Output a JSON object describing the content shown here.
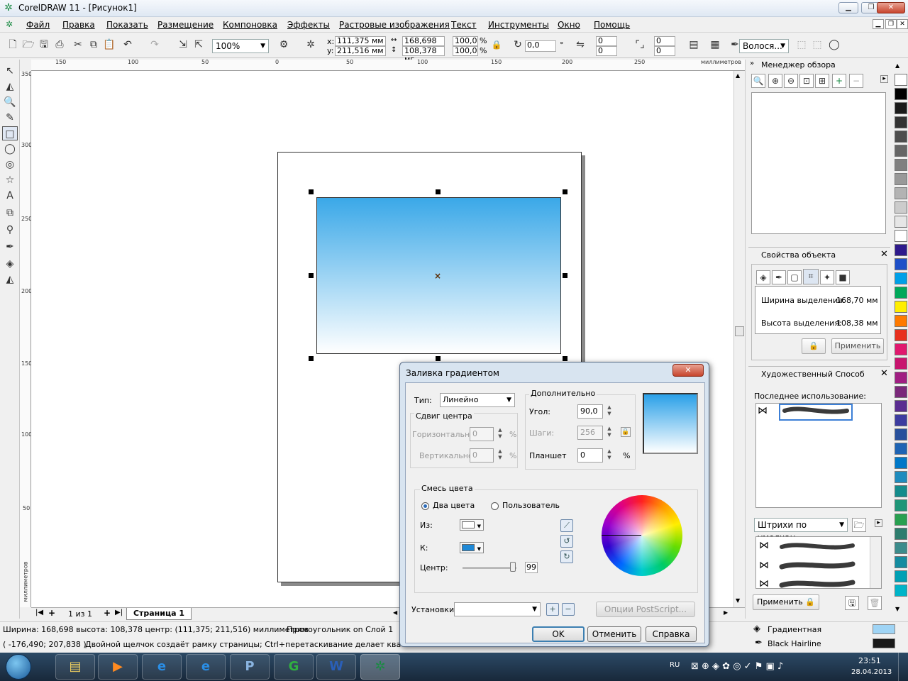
{
  "window": {
    "title": "CorelDRAW 11 - [Рисунок1]",
    "app_icon": "corel-balloon-icon"
  },
  "menu": [
    "Файл",
    "Правка",
    "Показать",
    "Размещение",
    "Компоновка",
    "Эффекты",
    "Растровые изображения",
    "Текст",
    "Инструменты",
    "Окно",
    "Помощь"
  ],
  "toolbar": {
    "zoom": "100%",
    "x_label": "x:",
    "x": "111,375 мм",
    "y_label": "y:",
    "y": "211,516 мм",
    "w": "168,698 мг",
    "h": "108,378 мг",
    "scale_x": "100,0",
    "scale_y": "100,0",
    "pct": "%",
    "angle": "0,0",
    "deg": "°",
    "corner1": "0",
    "corner2": "0",
    "corner3": "0",
    "corner4": "0",
    "outline": "Волося..."
  },
  "ruler": {
    "h_ticks": [
      "150",
      "100",
      "50",
      "0",
      "50",
      "100",
      "150",
      "200",
      "250"
    ],
    "units": "миллиметров",
    "v_ticks": [
      "350",
      "300",
      "250",
      "200",
      "150",
      "100",
      "50"
    ],
    "v_units": "миллиметров"
  },
  "pagebar": {
    "counter": "1 из 1",
    "tab": "Страница 1"
  },
  "status": {
    "line1": "Ширина: 168,698  высота: 108,378  центр: (111,375; 211,516)  миллиметров",
    "object": "Прямоугольник on Слой 1",
    "coords": "( -176,490; 207,838 )",
    "hint": "Двойной щелчок создаёт рамку страницы; Ctrl+перетаскивание делает квадрат; Shift+",
    "fill_label": "Градиентная",
    "outline_label": "Black  Hairline",
    "fill_color": "#9fd4f5",
    "outline_color": "#1a1a1a"
  },
  "docker": {
    "view_manager": {
      "title": "Менеджер обзора"
    },
    "object_props": {
      "title": "Свойства объекта",
      "width_label": "Ширина выделения:",
      "width_value": "168,70 мм",
      "height_label": "Высота выделения:",
      "height_value": "108,38 мм",
      "apply": "Применить"
    },
    "artistic": {
      "title": "Художественный Способ",
      "recent": "Последнее использование:",
      "preset": "Штрихи по умолчан...",
      "apply": "Применить"
    }
  },
  "dialog": {
    "title": "Заливка градиентом",
    "type_label": "Тип:",
    "type_value": "Линейно",
    "center_shift": "Сдвиг центра",
    "horiz_label": "Горизонтально:",
    "horiz_value": "0",
    "vert_label": "Вертикально:",
    "vert_value": "0",
    "pct": "%",
    "extra": "Дополнительно",
    "angle_label": "Угол:",
    "angle_value": "90,0",
    "steps_label": "Шаги:",
    "steps_value": "256",
    "pad_label": "Планшет",
    "pad_value": "0",
    "blend": "Смесь цвета",
    "two_colors": "Два цвета",
    "custom": "Пользователь",
    "from_label": "Из:",
    "to_label": "К:",
    "center_label": "Центр:",
    "center_value": "99",
    "center_pct": 99,
    "presets_label": "Установки:",
    "postscript": "Опции PostScript...",
    "ok": "OK",
    "cancel": "Отменить",
    "help": "Справка",
    "from_color": "#ffffff",
    "to_color": "#1e88d6",
    "preview_top": "#2aa0e8",
    "preview_bottom": "#ffffff"
  },
  "taskbar": {
    "lang": "RU",
    "time": "23:51",
    "date": "28.04.2013"
  },
  "palette": [
    "#ffffff",
    "#000000",
    "#1a1a1a",
    "#333333",
    "#4d4d4d",
    "#666666",
    "#808080",
    "#999999",
    "#b3b3b3",
    "#cccccc",
    "#e6e6e6",
    "#ffffff",
    "#2e1a8c",
    "#1e50c8",
    "#00a0e8",
    "#00a85a",
    "#ffee00",
    "#ff7a00",
    "#e8301e",
    "#e0186e",
    "#c8146e",
    "#a01e82",
    "#7a287a",
    "#5a2d91",
    "#3c3ca0",
    "#28509c",
    "#1e64b4",
    "#0078c8",
    "#1e8cbe",
    "#148c8c",
    "#1e9678",
    "#28a050",
    "#2e7d6e",
    "#3c8c8c",
    "#148ca0",
    "#00a0b4",
    "#00b4c8"
  ]
}
